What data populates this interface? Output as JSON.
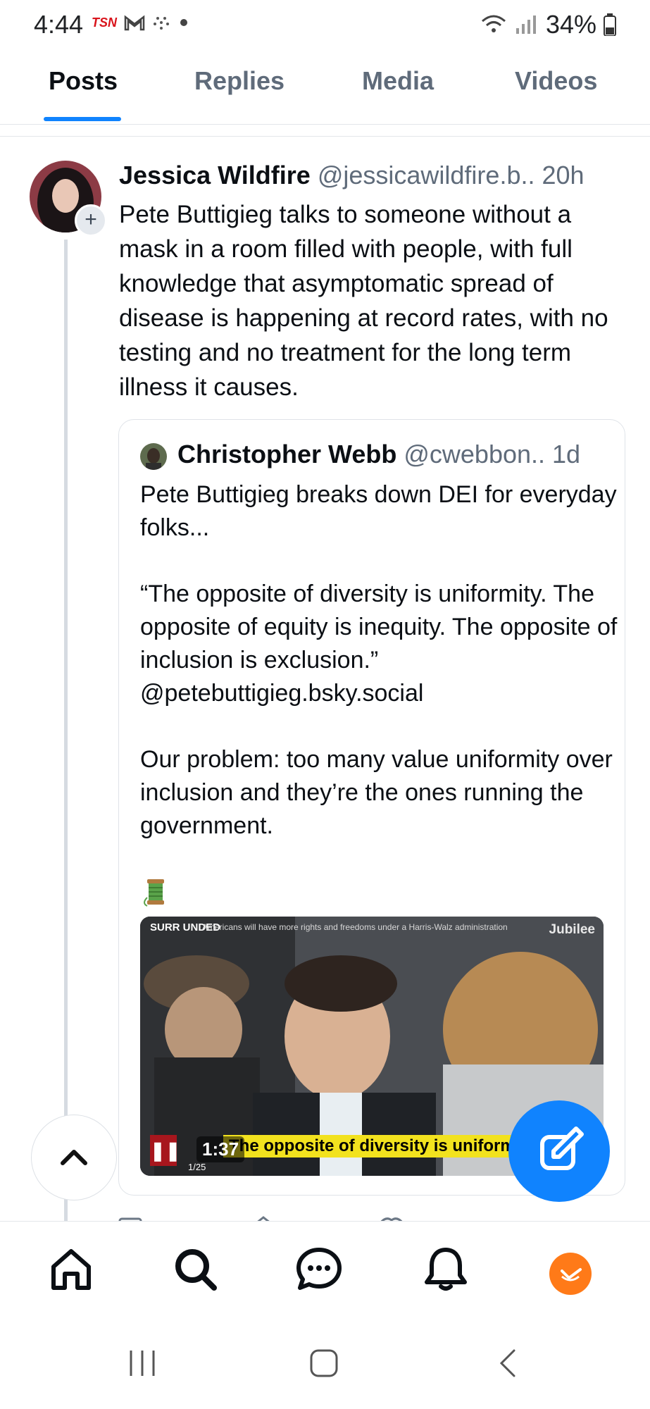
{
  "status_bar": {
    "time": "4:44",
    "app_icons": [
      "tsn-icon",
      "gmail-icon",
      "dots-icon"
    ],
    "tsn_label": "TSN",
    "battery": "34%"
  },
  "tabs": [
    {
      "label": "Posts",
      "active": true
    },
    {
      "label": "Replies",
      "active": false
    },
    {
      "label": "Media",
      "active": false
    },
    {
      "label": "Videos",
      "active": false
    }
  ],
  "post": {
    "author": "Jessica Wildfire",
    "handle": "@jessicawildfire.b..",
    "time": "20h",
    "text": "Pete Buttigieg talks to someone without a mask in a room filled with people, with full knowledge that asymptomatic spread of disease is happening at record rates, with no testing and no treatment for the long term illness it causes.",
    "follow_label": "+"
  },
  "quote": {
    "author": "Christopher Webb",
    "handle": "@cwebbon..",
    "time": "1d",
    "text": "Pete Buttigieg breaks down DEI for everyday folks...\n\n“The opposite of diversity is uniformity. The opposite of equity is inequity. The opposite of inclusion is exclusion.” @petebuttigieg.bsky.social\n\nOur problem: too many value uniformity over inclusion and they’re the ones running the government.",
    "emoji": "thread-spool-icon",
    "video": {
      "brand": "SURR UNDED",
      "tagline": "Americans will have more rights and freedoms under a Harris-Walz administration",
      "channel": "Jubilee",
      "caption": "The opposite of diversity is uniformit",
      "duration": "1:37",
      "page": "1/25",
      "playing": true
    }
  },
  "colors": {
    "accent": "#1083fe",
    "profile_orange": "#ff7a18",
    "caption_yellow": "#f2e21e"
  },
  "nav": [
    "home-icon",
    "search-icon",
    "chat-icon",
    "bell-icon",
    "profile-avatar"
  ]
}
